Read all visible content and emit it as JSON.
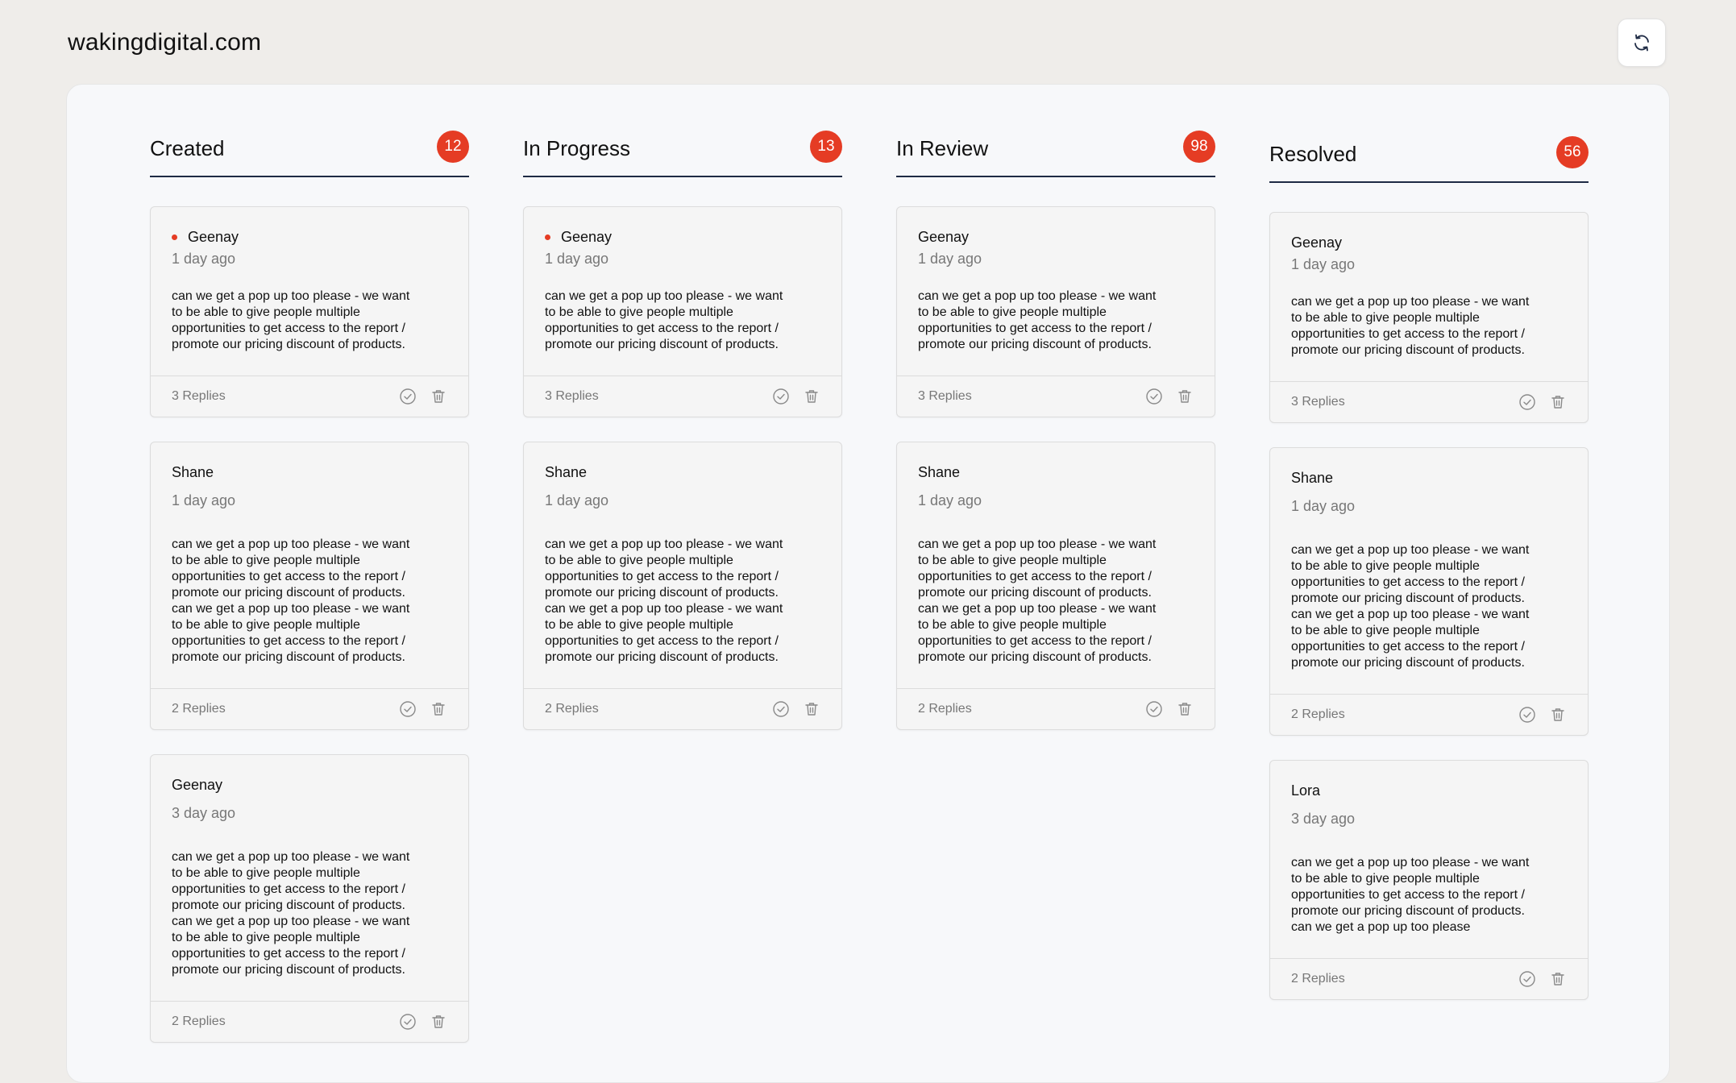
{
  "site": {
    "title": "wakingdigital.com"
  },
  "icons": {
    "refresh": "refresh-icon",
    "resolve": "check-circle-icon",
    "delete": "trash-icon"
  },
  "colors": {
    "badge": "#e53c24",
    "dot": "#e53c24",
    "divider": "#1e2a44"
  },
  "columns": [
    {
      "title": "Created",
      "count": "12",
      "cards": [
        {
          "author": "Geenay",
          "time": "1 day ago",
          "unread": true,
          "message": "can we get a pop up too please - we want\nto be able to give people multiple\nopportunities to get access to the report /\npromote our pricing discount of products.",
          "replies": "3 Replies"
        },
        {
          "author": "Shane",
          "time": "1 day ago",
          "unread": false,
          "message": "can we get a pop up too please - we want\nto be able to give people multiple\nopportunities to get access to the report /\npromote our pricing discount of products.\ncan we get a pop up too please - we want\nto be able to give people multiple\nopportunities to get access to the report /\npromote our pricing discount of products.",
          "replies": "2 Replies"
        },
        {
          "author": "Geenay",
          "time": "3 day ago",
          "unread": false,
          "message": "can we get a pop up too please - we want\nto be able to give people multiple\nopportunities to get access to the report /\npromote our pricing discount of products.\ncan we get a pop up too please - we want\nto be able to give people multiple\nopportunities to get access to the report /\npromote our pricing discount of products.",
          "replies": "2 Replies"
        }
      ]
    },
    {
      "title": "In Progress",
      "count": "13",
      "cards": [
        {
          "author": "Geenay",
          "time": "1 day ago",
          "unread": true,
          "message": "can we get a pop up too please - we want\nto be able to give people multiple\nopportunities to get access to the report /\npromote our pricing discount of products.",
          "replies": "3 Replies"
        },
        {
          "author": "Shane",
          "time": "1 day ago",
          "unread": false,
          "message": "can we get a pop up too please - we want\nto be able to give people multiple\nopportunities to get access to the report /\npromote our pricing discount of products.\ncan we get a pop up too please - we want\nto be able to give people multiple\nopportunities to get access to the report /\npromote our pricing discount of products.",
          "replies": "2 Replies"
        }
      ]
    },
    {
      "title": "In Review",
      "count": "98",
      "cards": [
        {
          "author": "Geenay",
          "time": "1 day ago",
          "unread": false,
          "message": "can we get a pop up too please - we want\nto be able to give people multiple\nopportunities to get access to the report /\npromote our pricing discount of products.",
          "replies": "3 Replies"
        },
        {
          "author": "Shane",
          "time": "1 day ago",
          "unread": false,
          "message": "can we get a pop up too please - we want\nto be able to give people multiple\nopportunities to get access to the report /\npromote our pricing discount of products.\ncan we get a pop up too please - we want\nto be able to give people multiple\nopportunities to get access to the report /\npromote our pricing discount of products.",
          "replies": "2 Replies"
        }
      ]
    },
    {
      "title": "Resolved",
      "count": "56",
      "cards": [
        {
          "author": "Geenay",
          "time": "1 day ago",
          "unread": false,
          "message": "can we get a pop up too please - we want\nto be able to give people multiple\nopportunities to get access to the report /\npromote our pricing discount of products.",
          "replies": "3 Replies"
        },
        {
          "author": "Shane",
          "time": "1 day ago",
          "unread": false,
          "message": "can we get a pop up too please - we want\nto be able to give people multiple\nopportunities to get access to the report /\npromote our pricing discount of products.\ncan we get a pop up too please - we want\nto be able to give people multiple\nopportunities to get access to the report /\npromote our pricing discount of products.",
          "replies": "2 Replies"
        },
        {
          "author": "Lora",
          "time": "3 day ago",
          "unread": false,
          "message": "can we get a pop up too please - we want\nto be able to give people multiple\nopportunities to get access to the report /\npromote our pricing discount of products.\ncan we get a pop up too please",
          "replies": "2 Replies"
        }
      ]
    }
  ]
}
